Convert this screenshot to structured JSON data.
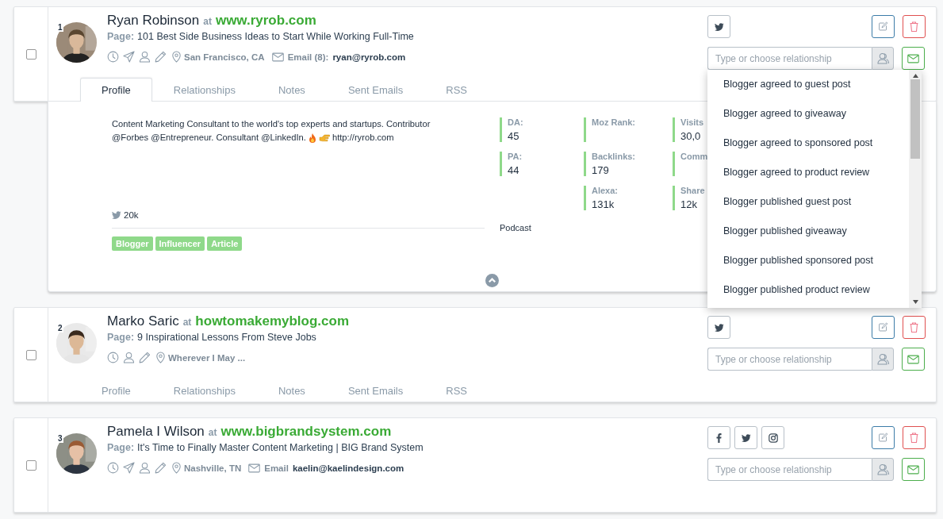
{
  "contacts": [
    {
      "number": "1",
      "name": "Ryan Robinson",
      "at": "at",
      "site": "www.ryrob.com",
      "page_label": "Page:",
      "page": "101 Best Side Business Ideas to Start While Working Full-Time",
      "sent": true,
      "location": "San Francisco, CA",
      "email_label": "Email (8):",
      "email": "ryan@ryrob.com",
      "checked": false,
      "socials": [
        {
          "kind": "twitter"
        }
      ],
      "relationship_placeholder": "Type or choose relationship",
      "dropdown_open": true,
      "options": [
        "Blogger agreed to guest post",
        "Blogger agreed to giveaway",
        "Blogger agreed to sponsored post",
        "Blogger agreed to product review",
        "Blogger published guest post",
        "Blogger published giveaway",
        "Blogger published sponsored post",
        "Blogger published product review"
      ],
      "tabs": [
        {
          "label": "Profile",
          "selected": true
        },
        {
          "label": "Relationships",
          "selected": false
        },
        {
          "label": "Notes",
          "selected": false
        },
        {
          "label": "Sent Emails",
          "selected": false
        },
        {
          "label": "RSS",
          "selected": false
        }
      ],
      "profile": {
        "bio_lines": [
          "Content Marketing Consultant to the world's top experts and startups. Contributor",
          "@Forbes @Entrepreneur. Consultant @LinkedIn."
        ],
        "link": "http://ryrob.com",
        "twitter_followers": "20k",
        "tags": [
          "Blogger",
          "Influencer",
          "Article"
        ],
        "stats": [
          [
            {
              "label": "DA:",
              "value": "45"
            },
            {
              "label": "PA:",
              "value": "44"
            }
          ],
          [
            {
              "label": "Moz Rank:"
            },
            {
              "label": "Backlinks:",
              "value": "179"
            },
            {
              "label": "Alexa:",
              "value": "131k"
            }
          ],
          [
            {
              "label": "Visits",
              "value": "30,0"
            },
            {
              "label": "Comm"
            },
            {
              "label": "Share",
              "value": "12k"
            }
          ]
        ],
        "category": "Podcast"
      }
    },
    {
      "number": "2",
      "name": "Marko Saric",
      "at": "at",
      "site": "howtomakemyblog.com",
      "page_label": "Page:",
      "page": "9 Inspirational Lessons From Steve Jobs",
      "sent": false,
      "location": "Wherever I May ...",
      "checked": false,
      "socials": [
        {
          "kind": "twitter"
        }
      ],
      "relationship_placeholder": "Type or choose relationship",
      "dropdown_open": false,
      "tabs": [
        {
          "label": "Profile",
          "selected": false
        },
        {
          "label": "Relationships",
          "selected": false
        },
        {
          "label": "Notes",
          "selected": false
        },
        {
          "label": "Sent Emails",
          "selected": false
        },
        {
          "label": "RSS",
          "selected": false
        }
      ]
    },
    {
      "number": "3",
      "name": "Pamela I Wilson",
      "at": "at",
      "site": "www.bigbrandsystem.com",
      "page_label": "Page:",
      "page": "It's Time to Finally Master Content Marketing | BIG Brand System",
      "sent": true,
      "location": "Nashville, TN",
      "email_label": "Email",
      "email": "kaelin@kaelindesign.com",
      "checked": false,
      "socials": [
        {
          "kind": "facebook"
        },
        {
          "kind": "twitter"
        },
        {
          "kind": "instagram"
        }
      ],
      "relationship_placeholder": "Type or choose relationship",
      "dropdown_open": false
    }
  ]
}
